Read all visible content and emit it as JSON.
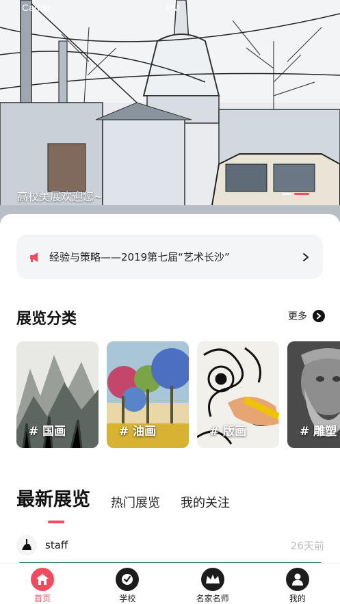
{
  "status_bar": {
    "carrier": "Carrier",
    "time": "PM"
  },
  "hero": {
    "caption": "高校美展欢迎您~",
    "slides": 3,
    "active_slide": 2
  },
  "notice": {
    "text": "经验与策略——2019第七届“艺术长沙”"
  },
  "categories_section": {
    "title": "展览分类",
    "more_label": "更多",
    "items": [
      {
        "label": "# 国画"
      },
      {
        "label": "# 油画"
      },
      {
        "label": "# 版画"
      },
      {
        "label": "# 雕塑"
      }
    ]
  },
  "tabs": [
    {
      "label": "最新展览",
      "active": true
    },
    {
      "label": "热门展览",
      "active": false
    },
    {
      "label": "我的关注",
      "active": false
    }
  ],
  "feed": [
    {
      "user": "staff",
      "ago": "26天前"
    }
  ],
  "bottom_nav": [
    {
      "label": "首页",
      "icon": "home-icon",
      "active": true
    },
    {
      "label": "学校",
      "icon": "school-icon",
      "active": false
    },
    {
      "label": "名家名师",
      "icon": "crown-icon",
      "active": false
    },
    {
      "label": "我的",
      "icon": "user-icon",
      "active": false
    }
  ],
  "colors": {
    "accent": "#f04b5f",
    "dark": "#1c1c1c",
    "notice_bg": "#f4f5f7"
  }
}
